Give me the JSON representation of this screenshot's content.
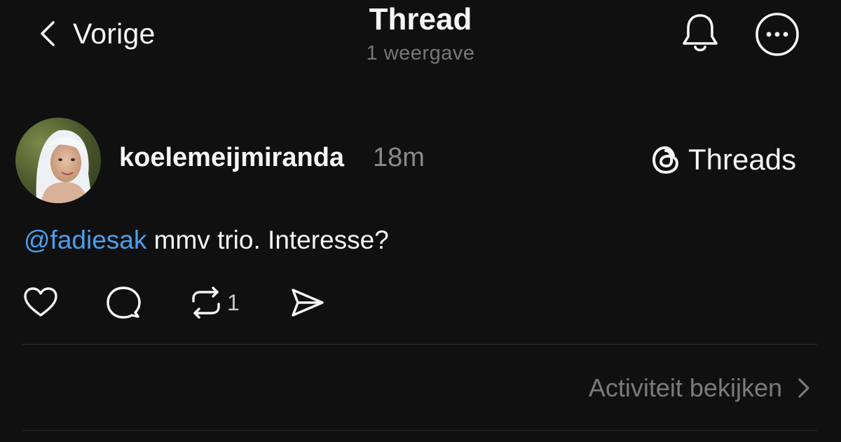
{
  "header": {
    "back_label": "Vorige",
    "title": "Thread",
    "subtitle": "1 weergave",
    "bell_icon": "bell-icon",
    "more_icon": "more-horizontal-circle-icon"
  },
  "post": {
    "username": "koelemeijmiranda",
    "timestamp": "18m",
    "app_link_label": "Threads",
    "app_icon": "threads-logo-icon",
    "mention": "@fadiesak",
    "text": " mmv trio. Interesse?",
    "actions": {
      "like_icon": "heart-icon",
      "comment_icon": "comment-icon",
      "repost_icon": "repost-icon",
      "repost_count": "1",
      "share_icon": "send-icon"
    }
  },
  "footer": {
    "activity_label": "Activiteit bekijken",
    "activity_icon": "chevron-right-icon"
  },
  "colors": {
    "background": "#101010",
    "text": "#f3f5f7",
    "muted": "#777777",
    "mention": "#4a9ff0",
    "divider": "#2c2c2c"
  }
}
